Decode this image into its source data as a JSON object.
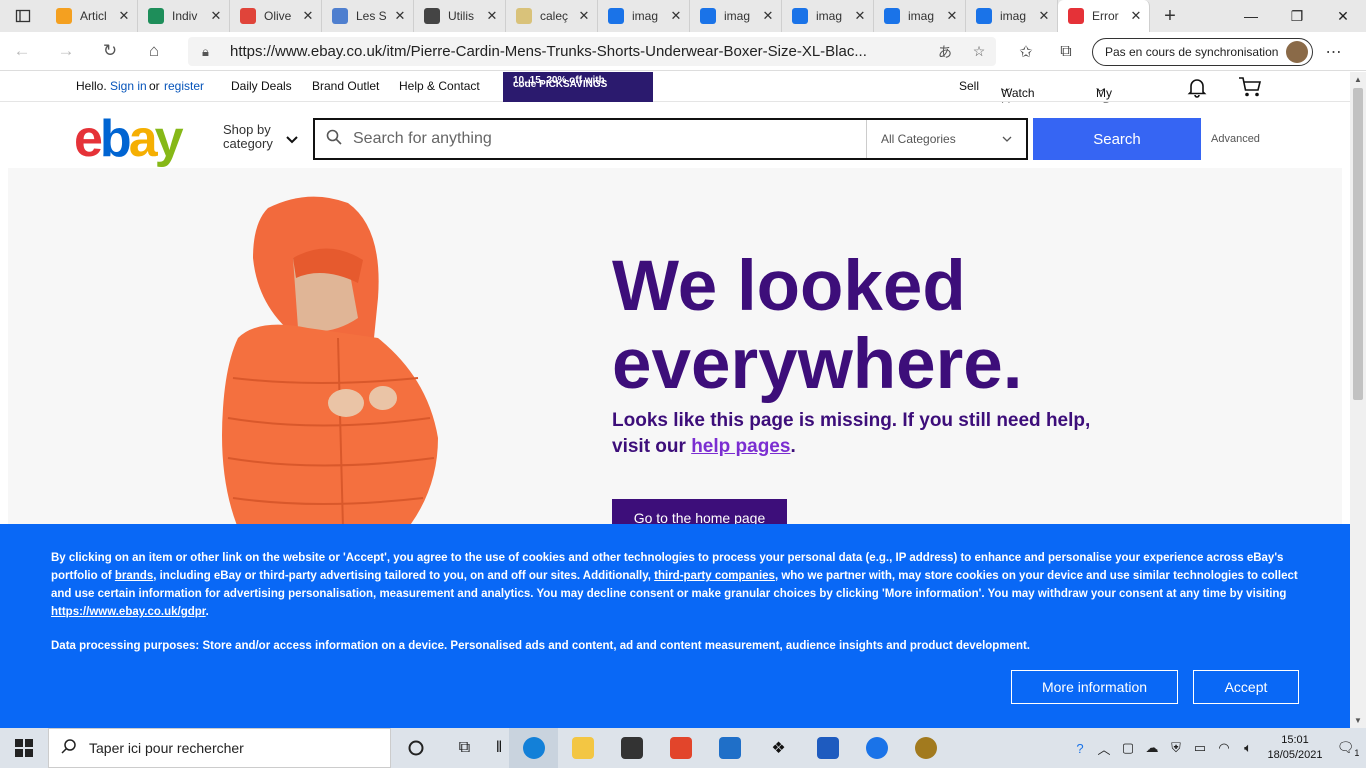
{
  "browser": {
    "tabs": [
      {
        "title": "Articl",
        "favicon_color": "#f4a020"
      },
      {
        "title": "Indiv",
        "favicon_color": "#1e8e5a"
      },
      {
        "title": "Olive",
        "favicon_color": "#e0443a"
      },
      {
        "title": "Les S",
        "favicon_color": "#4f7fcf"
      },
      {
        "title": "Utilis",
        "favicon_color": "#444444"
      },
      {
        "title": "caleç",
        "favicon_color": "#d9c27a"
      },
      {
        "title": "imag",
        "favicon_color": "#1a73e8"
      },
      {
        "title": "imag",
        "favicon_color": "#1a73e8"
      },
      {
        "title": "imag",
        "favicon_color": "#1a73e8"
      },
      {
        "title": "imag",
        "favicon_color": "#1a73e8"
      },
      {
        "title": "imag",
        "favicon_color": "#1a73e8"
      },
      {
        "title": "Error",
        "favicon_color": "#e53238",
        "active": true
      }
    ],
    "close_glyph": "✕",
    "new_tab_glyph": "+",
    "url": "https://www.ebay.co.uk/itm/Pierre-Cardin-Mens-Trunks-Shorts-Underwear-Boxer-Size-XL-Blac...",
    "sync_label": "Pas en cours de synchronisation"
  },
  "ebay": {
    "topnav": {
      "hello": "Hello.",
      "sign_in": "Sign in",
      "or": "or",
      "register": "register",
      "daily_deals": "Daily Deals",
      "brand_outlet": "Brand Outlet",
      "help_contact": "Help & Contact",
      "promo_line1": "10, 15, 20% off with",
      "promo_line2": "code PICKSAVINGS",
      "sell": "Sell",
      "watch_list": "Watch List",
      "my_ebay": "My eBay"
    },
    "logo_letters": [
      "e",
      "b",
      "a",
      "y"
    ],
    "logo_colors": [
      "#e53238",
      "#0064d2",
      "#f5af02",
      "#86b817"
    ],
    "shop_by_line1": "Shop by",
    "shop_by_line2": "category",
    "search_placeholder": "Search for anything",
    "category_selected": "All Categories",
    "search_button": "Search",
    "advanced": "Advanced"
  },
  "error_page": {
    "headline_line1": "We looked",
    "headline_line2": "everywhere.",
    "subtext": "Looks like this page is missing. If you still need help, visit our ",
    "help_link": "help pages",
    "subtext_end": ".",
    "home_button": "Go to the home page"
  },
  "cookie_banner": {
    "p1_a": "By clicking on an item or other link on the website or 'Accept', you agree to the use of cookies and other technologies to process your personal data (e.g., IP address) to enhance and personalise your experience across eBay's portfolio of ",
    "brands_link": "brands",
    "p1_b": ", including eBay or third-party advertising tailored to you, on and off our sites. Additionally, ",
    "third_party_link": "third-party companies",
    "p1_c": ", who we partner with, may store cookies on your device and use similar technologies to collect and use certain information for advertising personalisation, measurement and analytics. You may decline consent or make granular choices by clicking 'More information'. You may withdraw your consent at any time by visiting ",
    "gdpr_link": "https://www.ebay.co.uk/gdpr",
    "p1_d": ".",
    "p2": "Data processing purposes: Store and/or access information on a device. Personalised ads and content, ad and content measurement, audience insights and product development.",
    "more_info": "More information",
    "accept": "Accept"
  },
  "taskbar": {
    "search_placeholder": "Taper ici pour rechercher",
    "time": "15:01",
    "date": "18/05/2021",
    "notification_count": "1"
  }
}
